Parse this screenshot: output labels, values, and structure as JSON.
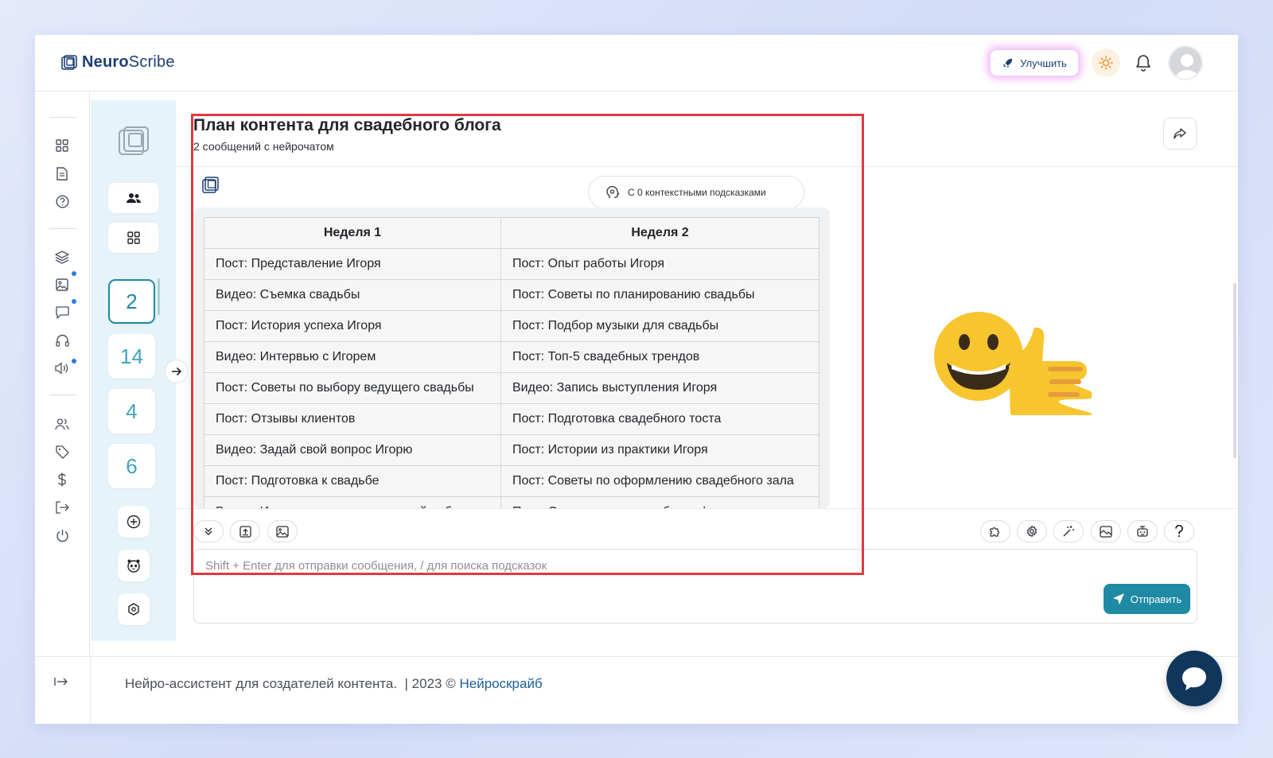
{
  "brand": {
    "name_bold": "Neuro",
    "name_rest": "Scribe"
  },
  "header": {
    "upgrade_label": "Улучшить"
  },
  "sessions": [
    "2",
    "14",
    "4",
    "6"
  ],
  "chat": {
    "title": "План контента для свадебного блога",
    "subtitle": "2 сообщений с нейрочатом",
    "hints_label": "С 0 контекстными подсказками",
    "table": {
      "headers": [
        "Неделя 1",
        "Неделя 2"
      ],
      "rows": [
        [
          "Пост: Представление Игоря",
          "Пост: Опыт работы Игоря"
        ],
        [
          "Видео: Съемка свадьбы",
          "Пост: Советы по планированию свадьбы"
        ],
        [
          "Пост: История успеха Игоря",
          "Пост: Подбор музыки для свадьбы"
        ],
        [
          "Видео: Интервью с Игорем",
          "Пост: Топ-5 свадебных трендов"
        ],
        [
          "Пост: Советы по выбору ведущего свадьбы",
          "Видео: Запись выступления Игоря"
        ],
        [
          "Пост: Отзывы клиентов",
          "Пост: Подготовка свадебного тоста"
        ],
        [
          "Видео: Задай свой вопрос Игорю",
          "Пост: Истории из практики Игоря"
        ],
        [
          "Пост: Подготовка к свадьбе",
          "Пост: Советы по оформлению свадебного зала"
        ],
        [
          "Видео: Игорь рассказывает о своей работе",
          "Пост: Организация свадебного фуршета"
        ]
      ]
    }
  },
  "composer": {
    "placeholder": "Shift + Enter для отправки сообщения, / для поиска подсказок",
    "send_label": "Отправить"
  },
  "footer": {
    "text": "Нейро-ассистент для создателей контента.  | 2023 © ",
    "link": "Нейроскрайб"
  },
  "colors": {
    "accent": "#1f8aa3",
    "brand": "#1d3f72",
    "highlight": "#e2393d",
    "fab": "#10365c"
  }
}
